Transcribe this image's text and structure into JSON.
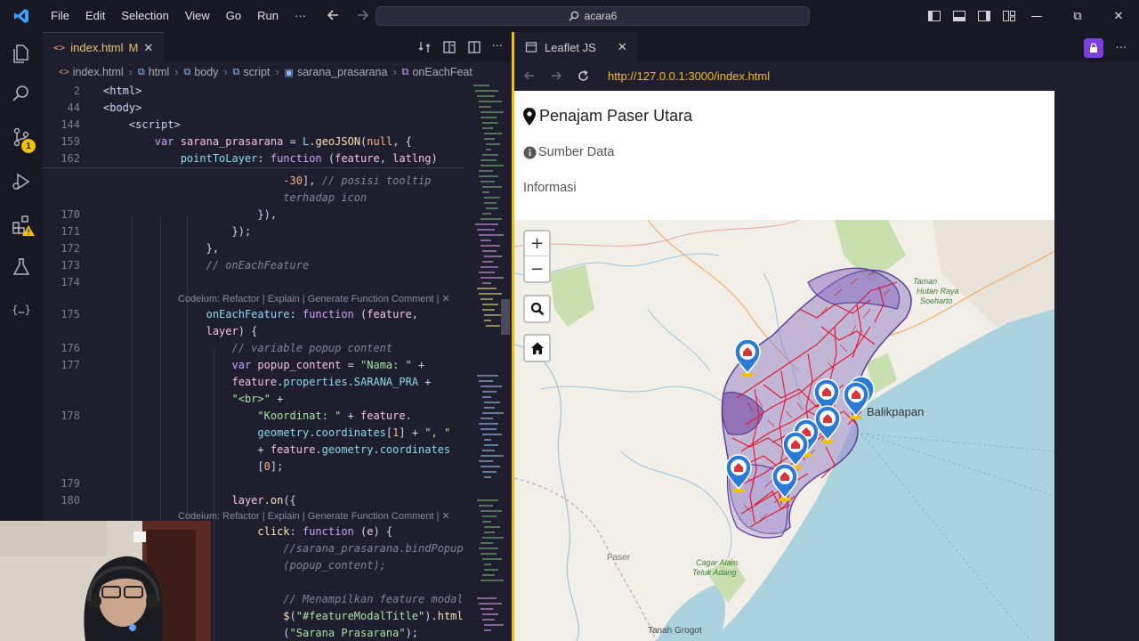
{
  "titlebar": {
    "menu": [
      "File",
      "Edit",
      "Selection",
      "View",
      "Go",
      "Run",
      "···"
    ],
    "search": "acara6"
  },
  "activity": {
    "source_control_badge": "1"
  },
  "editor": {
    "tab": {
      "filename": "index.html",
      "status": "M"
    },
    "breadcrumb": [
      "index.html",
      "html",
      "body",
      "script",
      "sarana_prasarana",
      "onEachFeat"
    ],
    "lens_text": "Codeium: Refactor | Explain | Generate Function Comment | ✕",
    "lines": [
      {
        "n": "2",
        "t": "<html>"
      },
      {
        "n": "44",
        "t": "<body>"
      },
      {
        "n": "144",
        "t": "    <script>"
      },
      {
        "n": "159",
        "t": "        var sarana_prasarana = L.geoJSON(null, {"
      },
      {
        "n": "162",
        "t": "            pointToLayer: function (feature, latlng)"
      },
      {
        "n": "",
        "t": "                            -30], // posisi tooltip"
      },
      {
        "n": "",
        "t": "                            terhadap icon"
      },
      {
        "n": "170",
        "t": "                        }),"
      },
      {
        "n": "171",
        "t": "                    });"
      },
      {
        "n": "172",
        "t": "                },"
      },
      {
        "n": "173",
        "t": "                // onEachFeature"
      },
      {
        "n": "174",
        "t": ""
      },
      {
        "n": "175",
        "t": "                onEachFeature: function (feature,"
      },
      {
        "n": "",
        "t": "                layer) {"
      },
      {
        "n": "176",
        "t": "                    // variable popup content"
      },
      {
        "n": "177",
        "t": "                    var popup_content = \"Nama: \" +"
      },
      {
        "n": "",
        "t": "                    feature.properties.SARANA_PRA +"
      },
      {
        "n": "",
        "t": "                    \"<br>\" +"
      },
      {
        "n": "178",
        "t": "                        \"Koordinat: \" + feature."
      },
      {
        "n": "",
        "t": "                        geometry.coordinates[1] + \", \""
      },
      {
        "n": "",
        "t": "                        + feature.geometry.coordinates"
      },
      {
        "n": "",
        "t": "                        [0];"
      },
      {
        "n": "179",
        "t": ""
      },
      {
        "n": "180",
        "t": "                    layer.on({"
      },
      {
        "n": "",
        "t": "                        click: function (e) {"
      },
      {
        "n": "",
        "t": "                            //sarana_prasarana.bindPopup"
      },
      {
        "n": "",
        "t": "                            (popup_content);"
      },
      {
        "n": "",
        "t": ""
      },
      {
        "n": "",
        "t": "                            // Menampilkan feature modal"
      },
      {
        "n": "",
        "t": "                            $(\"#featureModalTitle\").html"
      },
      {
        "n": "",
        "t": "                            (\"Sarana Prasarana\");"
      }
    ]
  },
  "browser": {
    "tab_title": "Leaflet JS",
    "url": "http://127.0.0.1:3000/index.html",
    "brand": "Penajam Paser Utara",
    "nav_sumber": "Sumber Data",
    "nav_informasi": "Informasi",
    "map_labels": {
      "taman1": "Taman",
      "taman2": "Hutan Raya",
      "taman3": "Soeharto",
      "balikpapan": "Balikpapan",
      "paser": "Paser",
      "cagar1": "Cagar Alam",
      "cagar2": "Teluk Adang",
      "tanah_grogot": "Tanah Grogot"
    },
    "zoom_in": "+",
    "zoom_out": "−"
  },
  "colors": {
    "accent": "#f2c200",
    "marker": "#2a7ad6",
    "marker_inner": "#d9343a",
    "roads": "#e0152b",
    "polygon": "#7b4fa8",
    "sea": "#aad3df"
  }
}
